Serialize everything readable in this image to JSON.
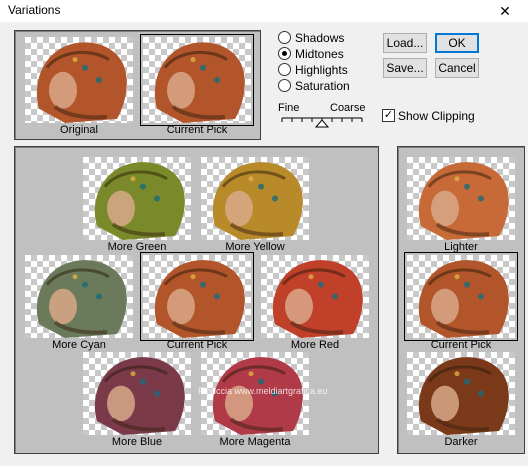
{
  "window": {
    "title": "Variations",
    "close_glyph": "✕"
  },
  "top_preview": {
    "original_label": "Original",
    "current_pick_label": "Current Pick"
  },
  "mode_options": [
    {
      "label": "Shadows",
      "selected": false
    },
    {
      "label": "Midtones",
      "selected": true
    },
    {
      "label": "Highlights",
      "selected": false
    },
    {
      "label": "Saturation",
      "selected": false
    }
  ],
  "buttons": {
    "load": "Load...",
    "save": "Save...",
    "ok": "OK",
    "cancel": "Cancel"
  },
  "slider": {
    "left_label": "Fine",
    "right_label": "Coarse",
    "ticks": 9,
    "position": 0.5
  },
  "show_clipping": {
    "label": "Show Clipping",
    "checked": true
  },
  "color_grid": {
    "more_green": "More Green",
    "more_yellow": "More Yellow",
    "more_cyan": "More Cyan",
    "current_pick": "Current Pick",
    "more_red": "More Red",
    "more_blue": "More Blue",
    "more_magenta": "More Magenta"
  },
  "brightness": {
    "lighter": "Lighter",
    "current_pick": "Current Pick",
    "darker": "Darker"
  },
  "watermark": "Pinuccia www.meldiartgrafica.eu",
  "tints": {
    "neutral": "#b2552a",
    "green": "#7a8a2a",
    "yellow": "#b88a2a",
    "cyan": "#6a7a5a",
    "red": "#c0402a",
    "blue": "#7a3a4a",
    "magenta": "#b03a48",
    "lighter": "#c86a38",
    "darker": "#7a3a1a"
  }
}
